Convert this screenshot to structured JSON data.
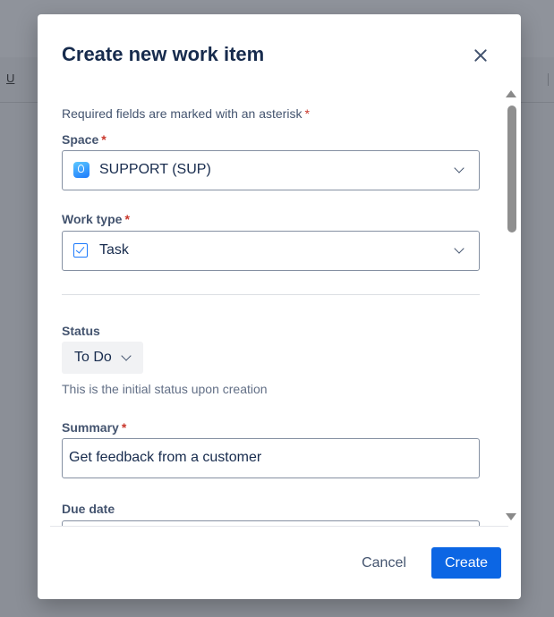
{
  "background": {
    "toolbar_glyph": "U"
  },
  "modal": {
    "title": "Create new work item",
    "required_note": "Required fields are marked with an asterisk",
    "asterisk": "*",
    "fields": {
      "space": {
        "label": "Space",
        "value": "SUPPORT (SUP)",
        "icon": "space-logo-icon"
      },
      "work_type": {
        "label": "Work type",
        "value": "Task",
        "icon": "task-checkbox-icon"
      },
      "status": {
        "label": "Status",
        "value": "To Do",
        "help": "This is the initial status upon creation"
      },
      "summary": {
        "label": "Summary",
        "value": "Get feedback from a customer"
      },
      "due_date": {
        "label": "Due date",
        "value": ""
      }
    },
    "buttons": {
      "cancel": "Cancel",
      "create": "Create"
    }
  },
  "colors": {
    "primary": "#0c66e4",
    "required": "#c9372c",
    "overlay": "#8b8f97"
  }
}
